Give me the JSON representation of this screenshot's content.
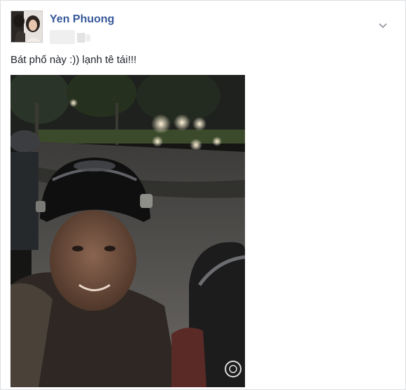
{
  "post": {
    "author_name": "Yen Phuong",
    "message": "Bát phố này :)) lạnh tê tái!!!",
    "avatar_icon": "profile-photo",
    "options_icon": "chevron-down-icon"
  },
  "colors": {
    "author_link": "#365899",
    "text": "#1d2129",
    "card_border": "#dddfe2"
  }
}
